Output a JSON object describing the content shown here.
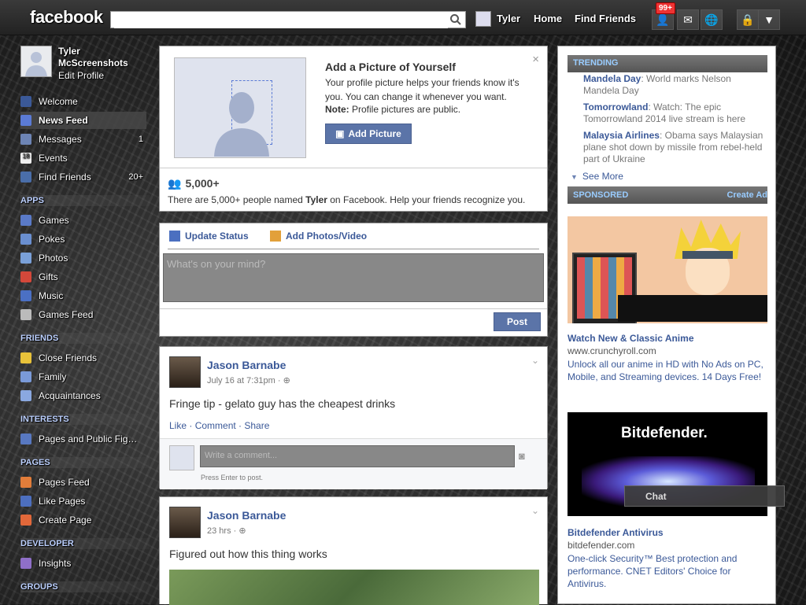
{
  "topbar": {
    "logo": "facebook",
    "search_placeholder": "",
    "user_name": "Tyler",
    "home": "Home",
    "find_friends": "Find Friends",
    "notification_count": "99+"
  },
  "profile": {
    "name": "Tyler McScreenshots",
    "edit": "Edit Profile"
  },
  "nav": {
    "welcome": "Welcome",
    "news_feed": "News Feed",
    "messages": "Messages",
    "messages_count": "1",
    "events": "Events",
    "find_friends": "Find Friends",
    "find_friends_count": "20+"
  },
  "sections": {
    "apps": "APPS",
    "friends": "FRIENDS",
    "interests": "INTERESTS",
    "pages": "PAGES",
    "developer": "DEVELOPER",
    "groups": "GROUPS"
  },
  "apps": [
    "Games",
    "Pokes",
    "Photos",
    "Gifts",
    "Music",
    "Games Feed"
  ],
  "friends": [
    "Close Friends",
    "Family",
    "Acquaintances"
  ],
  "interests": [
    "Pages and Public Fig…"
  ],
  "pages": [
    "Pages Feed",
    "Like Pages",
    "Create Page"
  ],
  "developer": [
    "Insights"
  ],
  "picture_prompt": {
    "title": "Add a Picture of Yourself",
    "body": "Your profile picture helps your friends know it's you. You can change it whenever you want.",
    "note_label": "Note:",
    "note_text": " Profile pictures are public.",
    "button": "Add Picture",
    "count": "5,000+",
    "people_text_pre": "There are 5,000+ people named ",
    "people_name": "Tyler",
    "people_text_post": " on Facebook. Help your friends recognize you."
  },
  "composer": {
    "update_status": "Update Status",
    "add_photos": "Add Photos/Video",
    "placeholder": "What's on your mind?",
    "post": "Post"
  },
  "posts": [
    {
      "author": "Jason Barnabe",
      "time": "July 16 at 7:31pm",
      "text": "Fringe tip - gelato guy has the cheapest drinks",
      "like": "Like",
      "comment": "Comment",
      "share": "Share",
      "comment_placeholder": "Write a comment...",
      "enter_hint": "Press Enter to post."
    },
    {
      "author": "Jason Barnabe",
      "time": "23 hrs",
      "text": "Figured out how this thing works"
    }
  ],
  "trending": {
    "header": "TRENDING",
    "items": [
      {
        "topic": "Mandela Day",
        "text": ": World marks Nelson Mandela Day"
      },
      {
        "topic": "Tomorrowland",
        "text": ": Watch: The epic Tomorrowland 2014 live stream is here"
      },
      {
        "topic": "Malaysia Airlines",
        "text": ": Obama says Malaysian plane shot down by missile from rebel-held part of Ukraine"
      }
    ],
    "see_more": "See More"
  },
  "sponsored": {
    "header": "SPONSORED",
    "create_ad": "Create Ad",
    "ads": [
      {
        "title": "Watch New & Classic Anime",
        "domain": "www.crunchyroll.com",
        "body": "Unlock all our anime in HD with No Ads on PC, Mobile, and Streaming devices. 14 Days Free!"
      },
      {
        "brand": "Bitdefender.",
        "title": "Bitdefender Antivirus",
        "domain": "bitdefender.com",
        "body": "One-click Security™ Best protection and performance. CNET Editors' Choice for Antivirus."
      }
    ]
  },
  "chat": {
    "label": "Chat"
  }
}
